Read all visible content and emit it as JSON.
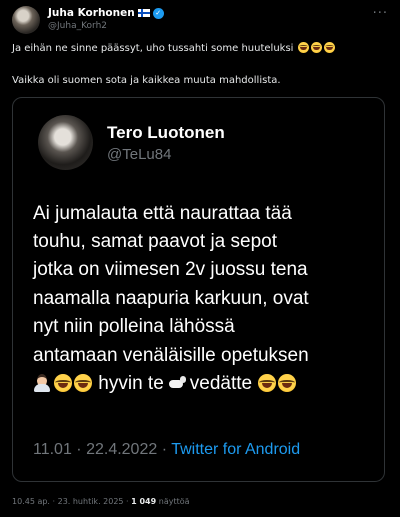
{
  "author": {
    "name": "Juha Korhonen",
    "handle": "@Juha_Korh2",
    "more_label": "···"
  },
  "tweet": {
    "line1": "Ja eihän ne sinne päässyt, uho tussahti some huuteluksi",
    "line1_emojis": [
      "face-with-tears-of-joy",
      "face-with-tears-of-joy",
      "face-with-tears-of-joy"
    ],
    "line2": "Vaikka oli suomen sota ja kaikkea muuta mahdollista."
  },
  "quoted": {
    "name": "Tero Luotonen",
    "handle": "@TeLu84",
    "lines": [
      "Ai jumalauta että naurattaa tää",
      "touhu, samat paavot ja sepot",
      "jotka on viimesen 2v juossu tena",
      "naamalla naapuria karkuun, ovat",
      "nyt niin polleina lähössä",
      "antamaan venäläisille opetuksen"
    ],
    "last_line_part1": "hyvin te",
    "last_line_part2": "vedätte",
    "last_line_emojis": [
      "man-facepalming",
      "face-with-tears-of-joy",
      "face-with-tears-of-joy",
      "goat",
      "face-with-tears-of-joy",
      "face-with-tears-of-joy"
    ],
    "timestamp": "11.01 · 22.4.2022 · ",
    "source": "Twitter for Android"
  },
  "footer": {
    "time": "10.45 ap. · 23. huhtik. 2025 · ",
    "views_count": "1 049",
    "views_label": " näyttöä"
  },
  "colors": {
    "background": "#000000",
    "text": "#e7e9ea",
    "muted": "#71767b",
    "accent": "#1d9bf0",
    "border": "#2f3336"
  }
}
